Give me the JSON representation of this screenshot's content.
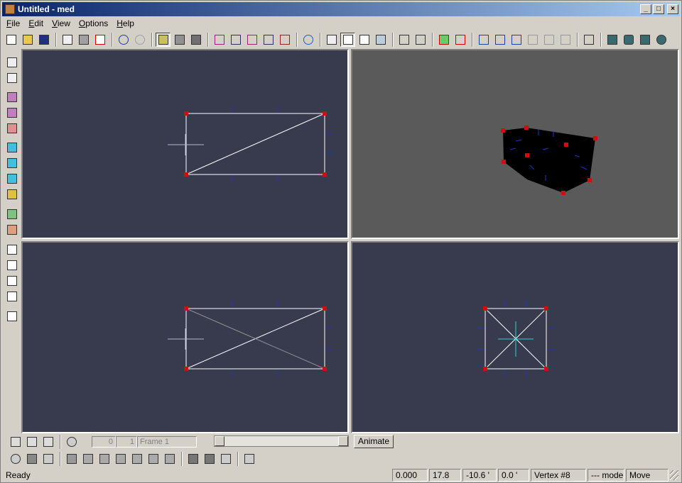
{
  "window": {
    "title": "Untitled - med"
  },
  "titlebar_buttons": {
    "minimize": "_",
    "maximize": "□",
    "close": "×"
  },
  "menu": [
    "File",
    "Edit",
    "View",
    "Options",
    "Help"
  ],
  "timeline": {
    "start_frame": "0",
    "frame_count": "1",
    "frame_label": "Frame 1",
    "animate_label": "Animate"
  },
  "status": {
    "message": "Ready",
    "x": "0.000",
    "y": "17.8",
    "z": "-10.6 '",
    "angle": "0.0 '",
    "selection": "Vertex #8",
    "mode": "--- mode---",
    "action": "Move"
  },
  "colors": {
    "viewport_bg": "#383a4e",
    "perspective_bg": "#5a5a5a",
    "wire": "#ffffff",
    "vertex": "#cc1010",
    "tick": "#2233cc"
  }
}
